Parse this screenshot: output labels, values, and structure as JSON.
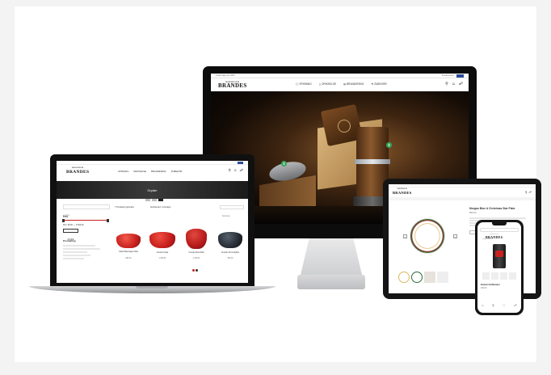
{
  "brand": {
    "line1": "BORNHOLM",
    "line2": "BRANDES",
    "accent_green": "#3aa65c",
    "dark": "#111111"
  },
  "desktop": {
    "topbar_left": "Gratis fragt over 999,-",
    "topbar_right": "Kundeservice",
    "nav": [
      {
        "label": "SPISNING",
        "icon": "plate-icon"
      },
      {
        "label": "DRIKKELSE",
        "icon": "glass-icon"
      },
      {
        "label": "BRANDERING",
        "icon": "drawer-icon"
      },
      {
        "label": "ZUBEHÖR",
        "icon": "tools-icon"
      }
    ],
    "hero_icon": "play-icon"
  },
  "laptop": {
    "nav": [
      {
        "label": "SPISNING"
      },
      {
        "label": "DRIKKELSE"
      },
      {
        "label": "BRANDERING"
      },
      {
        "label": "ZUBEHÖR"
      }
    ],
    "banner_title": "Gryder",
    "filter_placeholder": "Filtre",
    "filter_label": "Pris",
    "price_range": "Pris: 99,00 — 4.500,00",
    "filter_button": "FILTER",
    "stock_label": "Produkttyp",
    "toolbar_left": "7 Produkter gefunden",
    "toolbar_mid": "Ausblenden / Anzeigen",
    "sort_label": "Sortering",
    "products": [
      {
        "name": "Staub Brændejern Rød",
        "price": "899,00",
        "color": "#c8201e"
      },
      {
        "name": "Cocotte Ovale",
        "price": "1.099,00",
        "color": "#c41d1b"
      },
      {
        "name": "Cocotte Rund Rød",
        "price": "1.299,00",
        "color": "#b51a1a"
      },
      {
        "name": "Cocotte Sort Graphite",
        "price": "999,00",
        "color": "#262b33"
      }
    ]
  },
  "tablet": {
    "product_title": "Morgan Blue & Christmas Star Plate",
    "price": "899,00",
    "buy_button": "TILFØJ"
  },
  "phone": {
    "search_placeholder": "Søg produkter",
    "product_name": "Bodum Kaffekværn",
    "price": "499,00"
  }
}
